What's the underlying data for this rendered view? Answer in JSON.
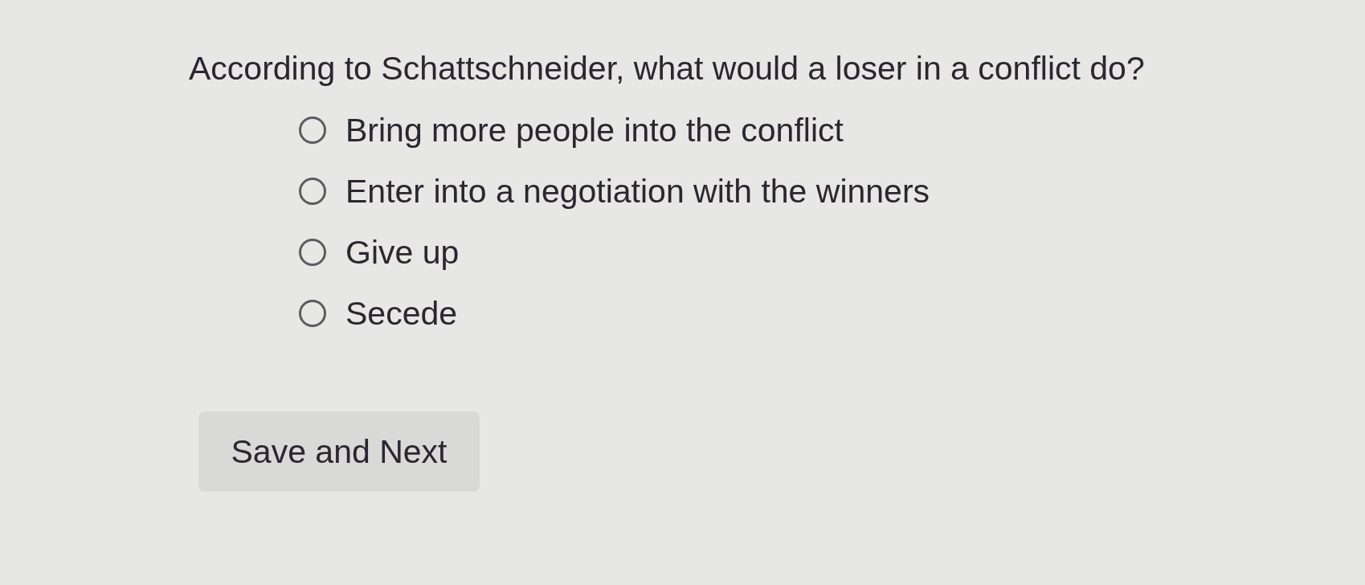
{
  "question": "According to Schattschneider, what would a loser in a conflict do?",
  "options": [
    {
      "label": "Bring more people into the conflict",
      "selected": false
    },
    {
      "label": "Enter into a negotiation with the winners",
      "selected": false
    },
    {
      "label": "Give up",
      "selected": false
    },
    {
      "label": "Secede",
      "selected": false
    }
  ],
  "button": {
    "label": "Save and Next"
  }
}
